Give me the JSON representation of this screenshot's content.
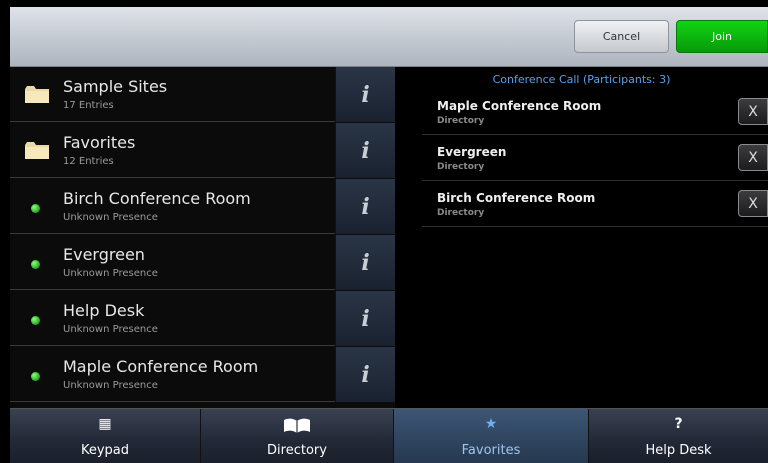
{
  "toolbar": {
    "cancel_label": "Cancel",
    "join_label": "Join"
  },
  "entries": [
    {
      "title": "Sample Sites",
      "sub": "17 Entries",
      "icon": "folder-icon"
    },
    {
      "title": "Favorites",
      "sub": "12 Entries",
      "icon": "folder-icon"
    },
    {
      "title": "Birch Conference Room",
      "sub": "Unknown Presence",
      "icon": "presence-dot-icon"
    },
    {
      "title": "Evergreen",
      "sub": "Unknown Presence",
      "icon": "presence-dot-icon"
    },
    {
      "title": "Help Desk",
      "sub": "Unknown Presence",
      "icon": "presence-dot-icon"
    },
    {
      "title": "Maple Conference Room",
      "sub": "Unknown Presence",
      "icon": "presence-dot-icon"
    }
  ],
  "info_glyph": "i",
  "conference": {
    "header": "Conference Call (Participants: 3)",
    "participants": [
      {
        "name": "Maple Conference Room",
        "source": "Directory"
      },
      {
        "name": "Evergreen",
        "source": "Directory"
      },
      {
        "name": "Birch Conference Room",
        "source": "Directory"
      }
    ],
    "remove_label": "X"
  },
  "nav": {
    "tabs": [
      {
        "label": "Keypad",
        "icon": "keypad-icon",
        "glyph": "▦"
      },
      {
        "label": "Directory",
        "icon": "book-icon",
        "glyph": ""
      },
      {
        "label": "Favorites",
        "icon": "star-icon",
        "glyph": "★",
        "active": true
      },
      {
        "label": "Help Desk",
        "icon": "question-icon",
        "glyph": "?"
      }
    ]
  },
  "colors": {
    "join": "#0db30f",
    "accent": "#5aa0e8",
    "presence": "#2fcf2a"
  }
}
